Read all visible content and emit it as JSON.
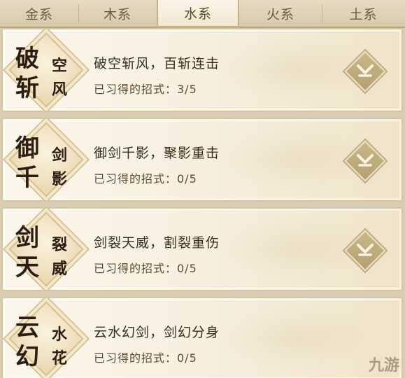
{
  "tabs": [
    {
      "label": "金系",
      "active": false
    },
    {
      "label": "木系",
      "active": false
    },
    {
      "label": "水系",
      "active": true
    },
    {
      "label": "火系",
      "active": false
    },
    {
      "label": "土系",
      "active": false
    }
  ],
  "skills": [
    {
      "emblem": [
        "破",
        "斩",
        "空",
        "风"
      ],
      "title": "破空斩风，百斩连击",
      "progress": "已习得的招式：3/5"
    },
    {
      "emblem": [
        "御",
        "千",
        "剑",
        "影"
      ],
      "title": "御剑千影，聚影重击",
      "progress": "已习得的招式：0/5"
    },
    {
      "emblem": [
        "剑",
        "天",
        "裂",
        "威"
      ],
      "title": "剑裂天威，割裂重伤",
      "progress": "已习得的招式：0/5"
    },
    {
      "emblem": [
        "云",
        "幻",
        "水",
        "花"
      ],
      "title": "云水幻剑，剑幻分身",
      "progress": "已习得的招式：0/5"
    }
  ],
  "watermark": "九游",
  "colors": {
    "accent": "#b4a16f",
    "text": "#3a2c1c"
  }
}
